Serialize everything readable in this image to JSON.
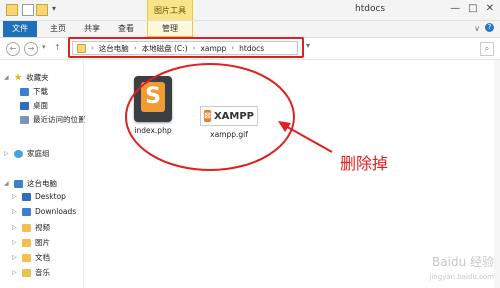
{
  "titlebar": {
    "context_tab": "图片工具",
    "title": "htdocs",
    "window_controls": [
      "—",
      "□",
      "✕"
    ]
  },
  "ribbon": {
    "tabs": [
      {
        "label": "文件"
      },
      {
        "label": "主页"
      },
      {
        "label": "共享"
      },
      {
        "label": "查看"
      },
      {
        "label": "管理"
      }
    ]
  },
  "address": {
    "crumbs": [
      "这台电脑",
      "本地磁盘 (C:)",
      "xampp",
      "htdocs"
    ]
  },
  "sidebar": {
    "favorites": {
      "label": "收藏夹",
      "items": [
        "下载",
        "桌面",
        "最近访问的位置"
      ]
    },
    "homegroup": "家庭组",
    "thispc": {
      "label": "这台电脑",
      "items": [
        "Desktop",
        "Downloads",
        "视频",
        "图片",
        "文档",
        "音乐"
      ]
    }
  },
  "files": [
    {
      "name": "index.php",
      "icon": "sublime-text-icon"
    },
    {
      "name": "xampp.gif",
      "icon": "xampp-logo-icon",
      "logo_text": "XAMPP"
    }
  ],
  "annotation": {
    "text": "删除掉",
    "color": "#e02020"
  },
  "watermark": {
    "line1": "Baidu 经验",
    "line2": "jingyan.baidu.com"
  }
}
